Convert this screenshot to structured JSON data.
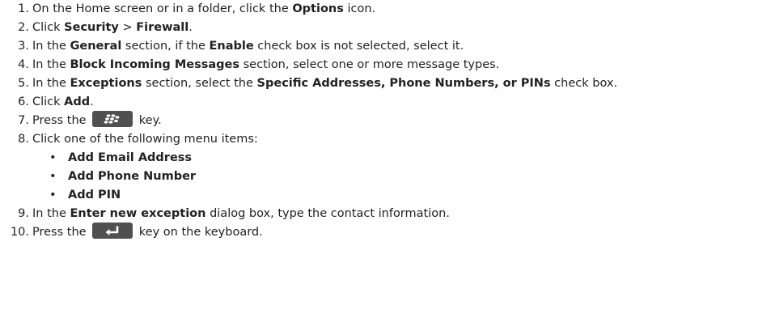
{
  "steps": [
    {
      "num": "1.",
      "parts": [
        "On the Home screen or in a folder, click the ",
        "Options",
        " icon."
      ]
    },
    {
      "num": "2.",
      "parts": [
        "Click ",
        "Security",
        " > ",
        "Firewall",
        "."
      ]
    },
    {
      "num": "3.",
      "parts": [
        "In the ",
        "General",
        " section, if the ",
        "Enable",
        " check box is not selected, select it."
      ]
    },
    {
      "num": "4.",
      "parts": [
        "In the ",
        "Block Incoming Messages",
        " section, select one or more message types."
      ]
    },
    {
      "num": "5.",
      "parts": [
        "In the ",
        "Exceptions",
        " section, select the ",
        "Specific Addresses, Phone Numbers, or PINs",
        " check box."
      ]
    },
    {
      "num": "6.",
      "parts": [
        "Click ",
        "Add",
        "."
      ]
    },
    {
      "num": "7.",
      "parts": [
        "Press the ",
        " key."
      ]
    },
    {
      "num": "8.",
      "parts": [
        "Click one of the following menu items:"
      ]
    },
    {
      "num": "9.",
      "parts": [
        "In the ",
        "Enter new exception",
        " dialog box, type the contact information."
      ]
    },
    {
      "num": "10.",
      "parts": [
        "Press the ",
        " key on the keyboard."
      ]
    }
  ],
  "menu_items": [
    "Add Email Address",
    "Add Phone Number",
    "Add PIN"
  ],
  "bullet_char": "•",
  "icons": {
    "menu_key": "blackberry-menu-key-icon",
    "enter_key": "enter-key-icon"
  },
  "colors": {
    "key_background": "#505050",
    "key_glyph": "#ffffff",
    "text": "#222222"
  }
}
